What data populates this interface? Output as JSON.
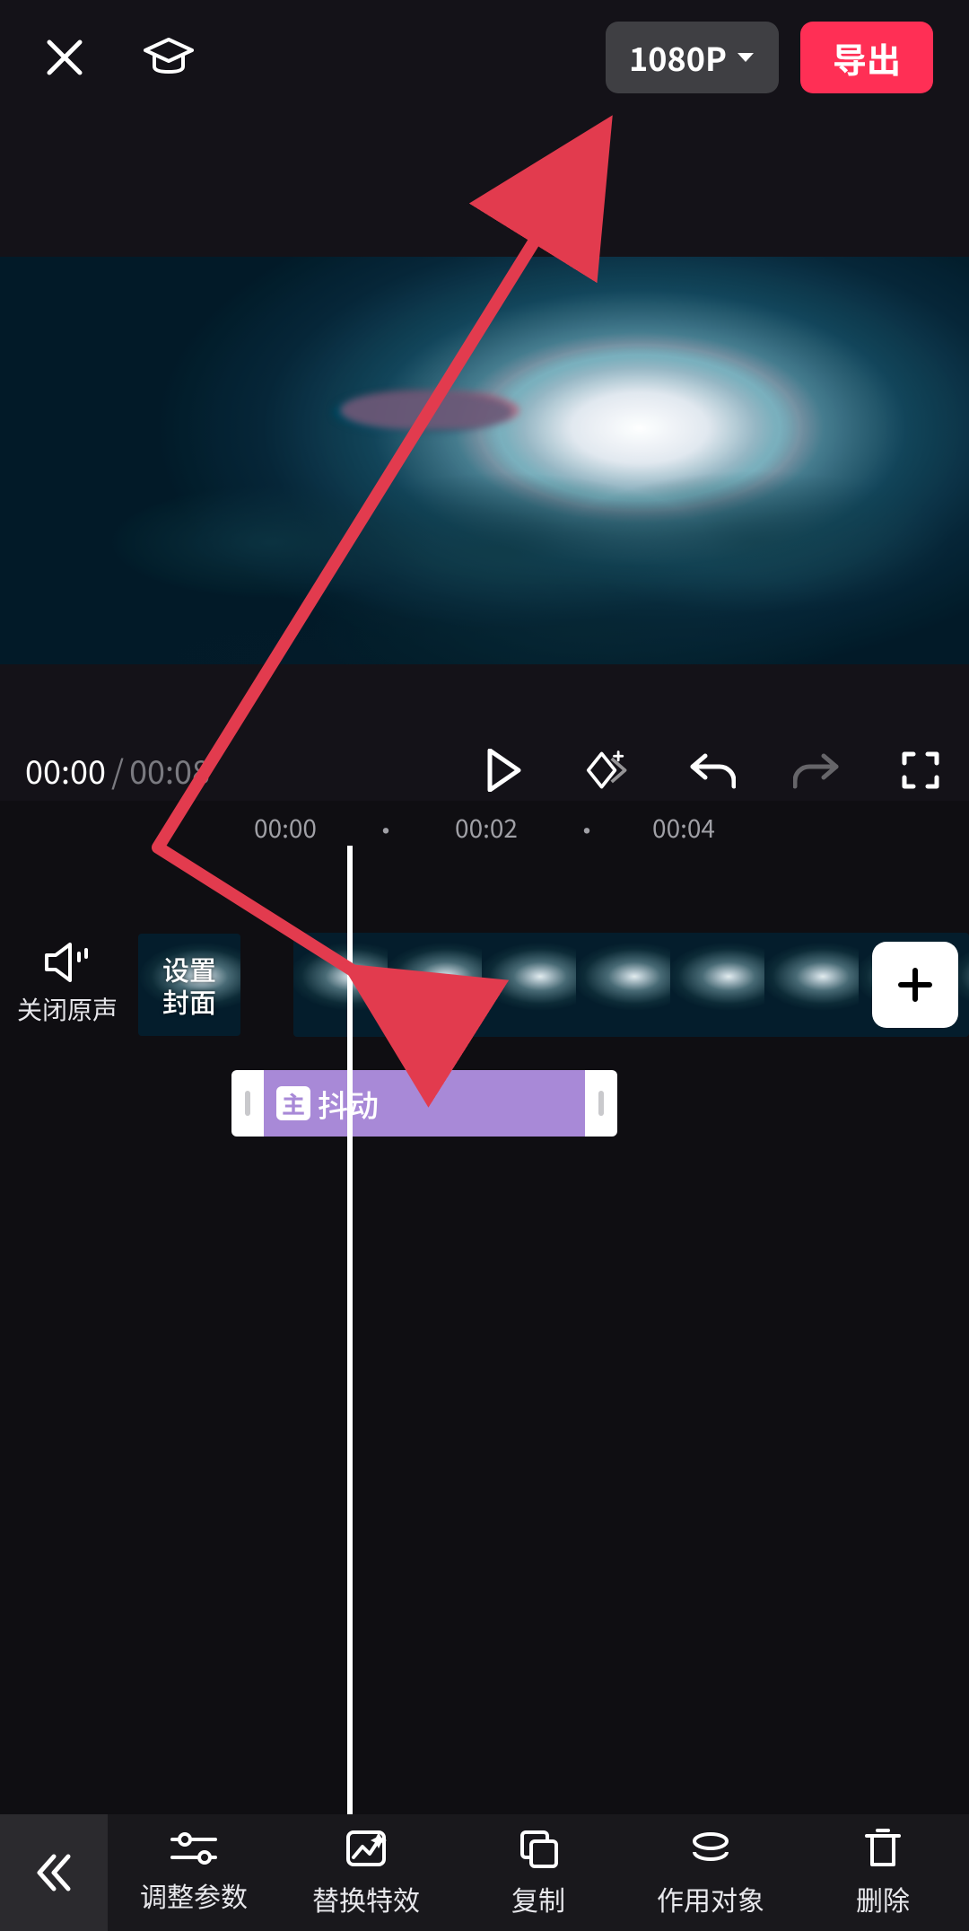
{
  "header": {
    "resolution_label": "1080P",
    "export_label": "导出"
  },
  "player": {
    "current_time": "00:00",
    "total_time": "00:08"
  },
  "timeline": {
    "ruler": [
      "00:00",
      "00:02",
      "00:04"
    ],
    "mute_label": "关闭原声",
    "cover_label_line1": "设置",
    "cover_label_line2": "封面",
    "effect_label": "抖动",
    "effect_icon_char": "主"
  },
  "toolbar": {
    "items": [
      {
        "label": "调整参数"
      },
      {
        "label": "替换特效"
      },
      {
        "label": "复制"
      },
      {
        "label": "作用对象"
      },
      {
        "label": "删除"
      }
    ]
  },
  "annotation": {
    "color": "#e23b4e"
  }
}
